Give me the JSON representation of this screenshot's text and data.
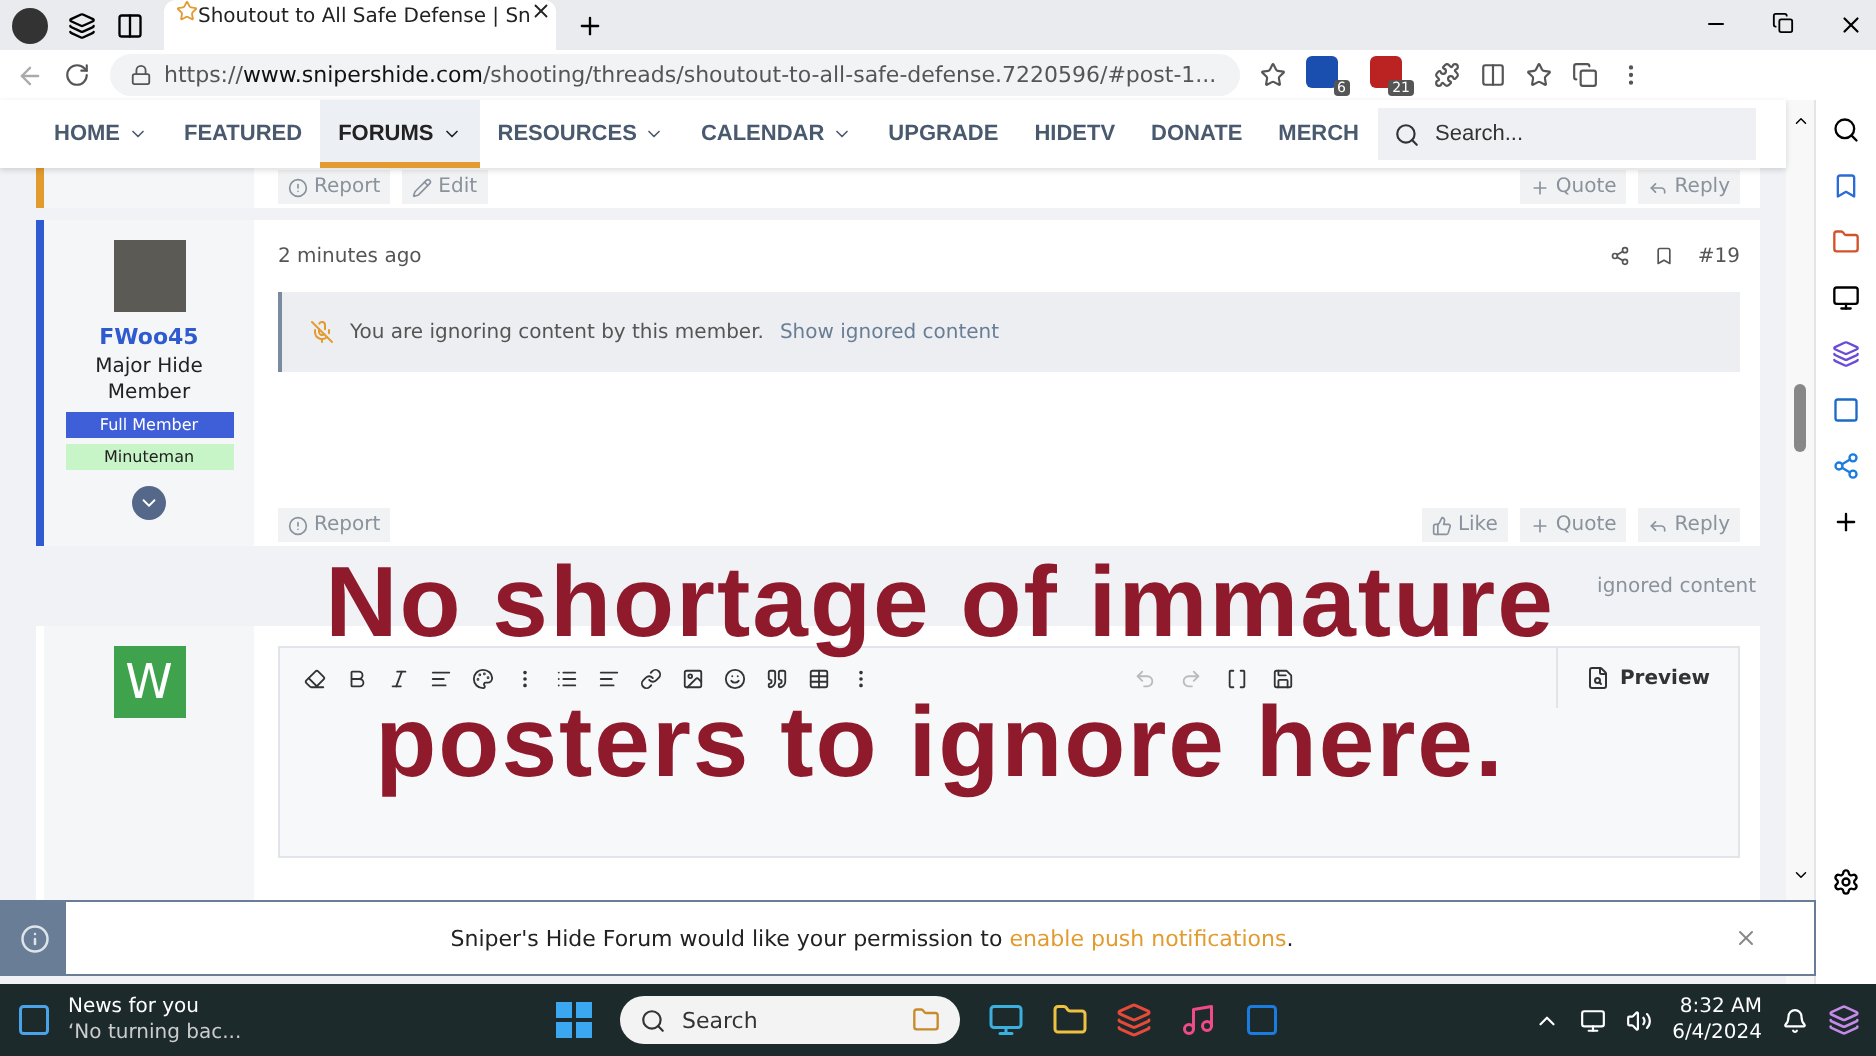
{
  "browser": {
    "tabs": [
      {
        "title": "Shoutout to All Safe Defense | Sn",
        "selected": true
      }
    ],
    "url": {
      "prefix": "https://",
      "domain": "www.snipershide.com",
      "path": "/shooting/threads/shoutout-to-all-safe-defense.7220596/#post-1..."
    },
    "badges": [
      "6",
      "21"
    ]
  },
  "nav": {
    "items": [
      {
        "label": "HOME",
        "selected": false,
        "dropdown": true
      },
      {
        "label": "FEATURED",
        "selected": false,
        "dropdown": false
      },
      {
        "label": "FORUMS",
        "selected": true,
        "dropdown": true
      },
      {
        "label": "RESOURCES",
        "selected": false,
        "dropdown": true
      },
      {
        "label": "CALENDAR",
        "selected": false,
        "dropdown": true
      },
      {
        "label": "UPGRADE",
        "selected": false,
        "dropdown": false
      },
      {
        "label": "HIDETV",
        "selected": false,
        "dropdown": false
      },
      {
        "label": "DONATE",
        "selected": false,
        "dropdown": false
      },
      {
        "label": "MERCH",
        "selected": false,
        "dropdown": false
      }
    ],
    "search": {
      "placeholder": "Search..."
    }
  },
  "previous_post": {
    "actions_left": [
      "Report",
      "Edit"
    ],
    "actions_right": [
      "Quote",
      "Reply"
    ]
  },
  "post": {
    "username": "FWoo45",
    "user_title": "Major Hide Member",
    "banners": [
      {
        "label": "Full Member",
        "color": "#3f5fd8"
      },
      {
        "label": "Minuteman",
        "color": "#c8f5c8"
      }
    ],
    "time": "2 minutes ago",
    "number": "#19",
    "notice": "You are ignoring content by this member.",
    "notice_link": "Show ignored content",
    "actions_left": [
      "Report"
    ],
    "actions_right": [
      "Like",
      "Quote",
      "Reply"
    ]
  },
  "ignored_link": "ignored content",
  "editor": {
    "avatar_letter": "W",
    "preview": "Preview"
  },
  "caption": [
    "No shortage of immature",
    "posters to ignore here."
  ],
  "notification": {
    "text": "Sniper's Hide Forum would like your permission to ",
    "link": "enable push notifications",
    "end": "."
  },
  "taskbar": {
    "news_title": "News for you",
    "news_subtitle": "‘No turning bac...",
    "search": "Search",
    "time": "8:32 AM",
    "date": "6/4/2024"
  }
}
